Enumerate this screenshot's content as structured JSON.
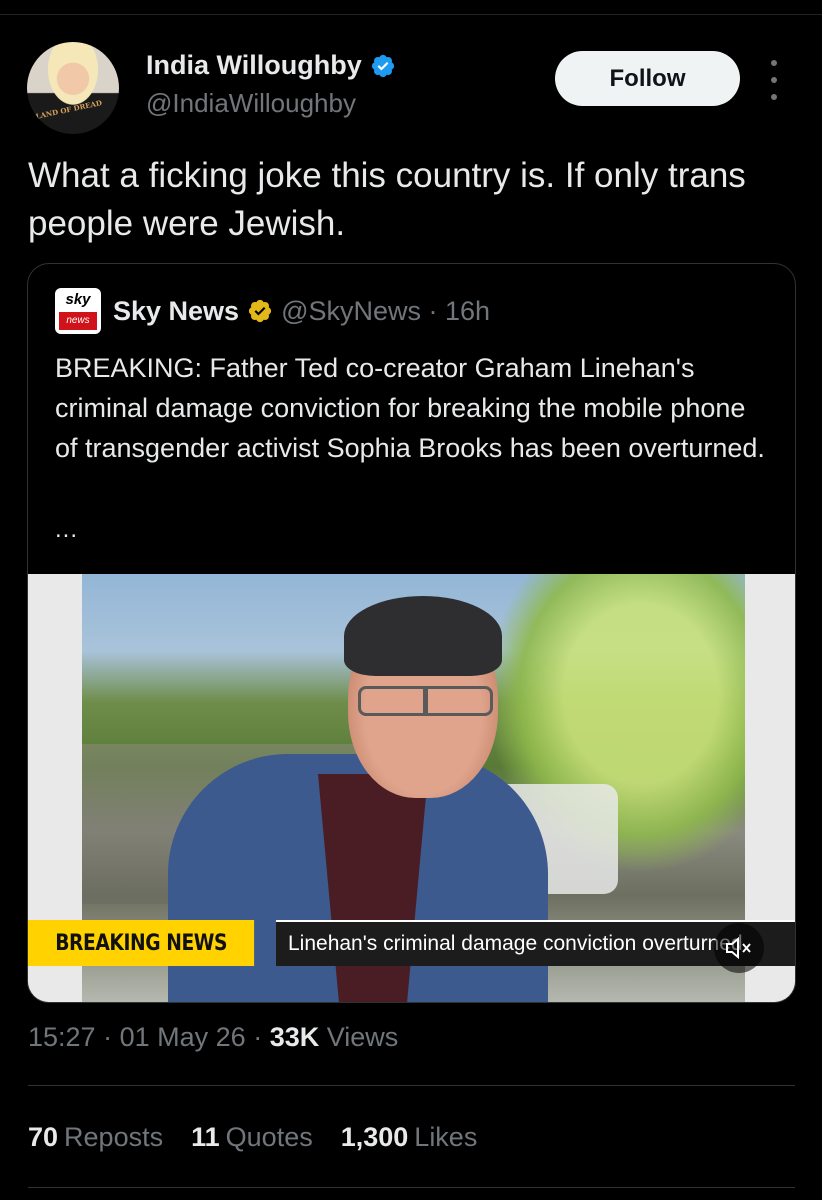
{
  "author": {
    "display_name": "India Willoughby",
    "handle": "@IndiaWilloughby",
    "avatar_shirt_text": "LAND OF DREAD",
    "verified_color": "#1d9bf0"
  },
  "follow_label": "Follow",
  "tweet_text": "What a ficking joke this country is. If only trans people were Jewish.",
  "quoted": {
    "logo_top": "sky",
    "logo_bottom": "news",
    "display_name": "Sky News",
    "handle_time": "@SkyNews · 16h",
    "badge_color": "#e2b719",
    "text": "BREAKING: Father Ted co-creator Graham Linehan's criminal damage conviction for breaking the mobile phone of transgender activist Sophia Brooks has been overturned.",
    "ellipsis": "...",
    "ticker_label": "BREAKING NEWS",
    "ticker_text": "Linehan's criminal damage conviction overturned"
  },
  "meta": {
    "time": "15:27",
    "date": "01 May 26",
    "views_count": "33K",
    "views_label": "Views"
  },
  "stats": {
    "reposts_count": "70",
    "reposts_label": "Reposts",
    "quotes_count": "11",
    "quotes_label": "Quotes",
    "likes_count": "1,300",
    "likes_label": "Likes"
  }
}
